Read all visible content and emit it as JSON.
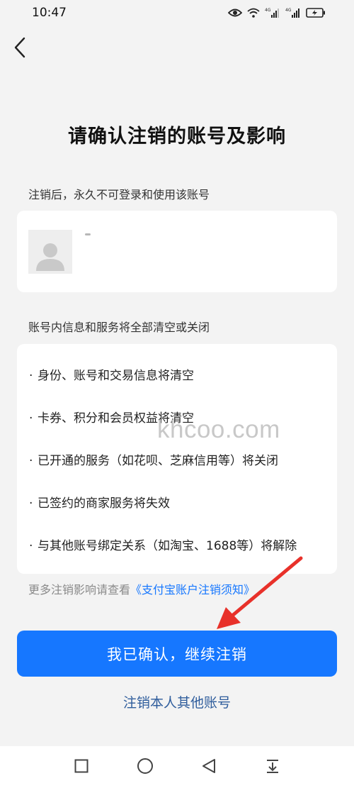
{
  "status_bar": {
    "time": "10:47",
    "network_1": "4G",
    "network_2": "4G",
    "icons": [
      "eye-icon",
      "wifi-icon",
      "signal-icon",
      "signal-icon",
      "battery-icon"
    ]
  },
  "header": {
    "back_icon": "chevron-left-icon",
    "title": "请确认注销的账号及影响"
  },
  "account_section": {
    "label": "注销后，永久不可登录和使用该账号",
    "avatar_icon": "user-avatar-icon"
  },
  "impact_section": {
    "label": "账号内信息和服务将全部清空或关闭",
    "bullet": "·",
    "items": [
      "身份、账号和交易信息将清空",
      "卡券、积分和会员权益将清空",
      "已开通的服务（如花呗、芝麻信用等）将关闭",
      "已签约的商家服务将失效",
      "与其他账号绑定关系（如淘宝、1688等）将解除"
    ]
  },
  "watermark": "khcoo.com",
  "more_info": {
    "prefix": "更多注销影响请查看",
    "link": "《支付宝账户注销须知》"
  },
  "actions": {
    "confirm_label": "我已确认，继续注销",
    "other_account_label": "注销本人其他账号"
  },
  "annotation": {
    "arrow_color": "#e8312a"
  },
  "colors": {
    "primary": "#1677ff",
    "background": "#f3f3f3",
    "link_dark": "#2f5d9c"
  },
  "nav_bar": {
    "icons": [
      "square-icon",
      "circle-icon",
      "triangle-back-icon",
      "download-icon"
    ]
  }
}
